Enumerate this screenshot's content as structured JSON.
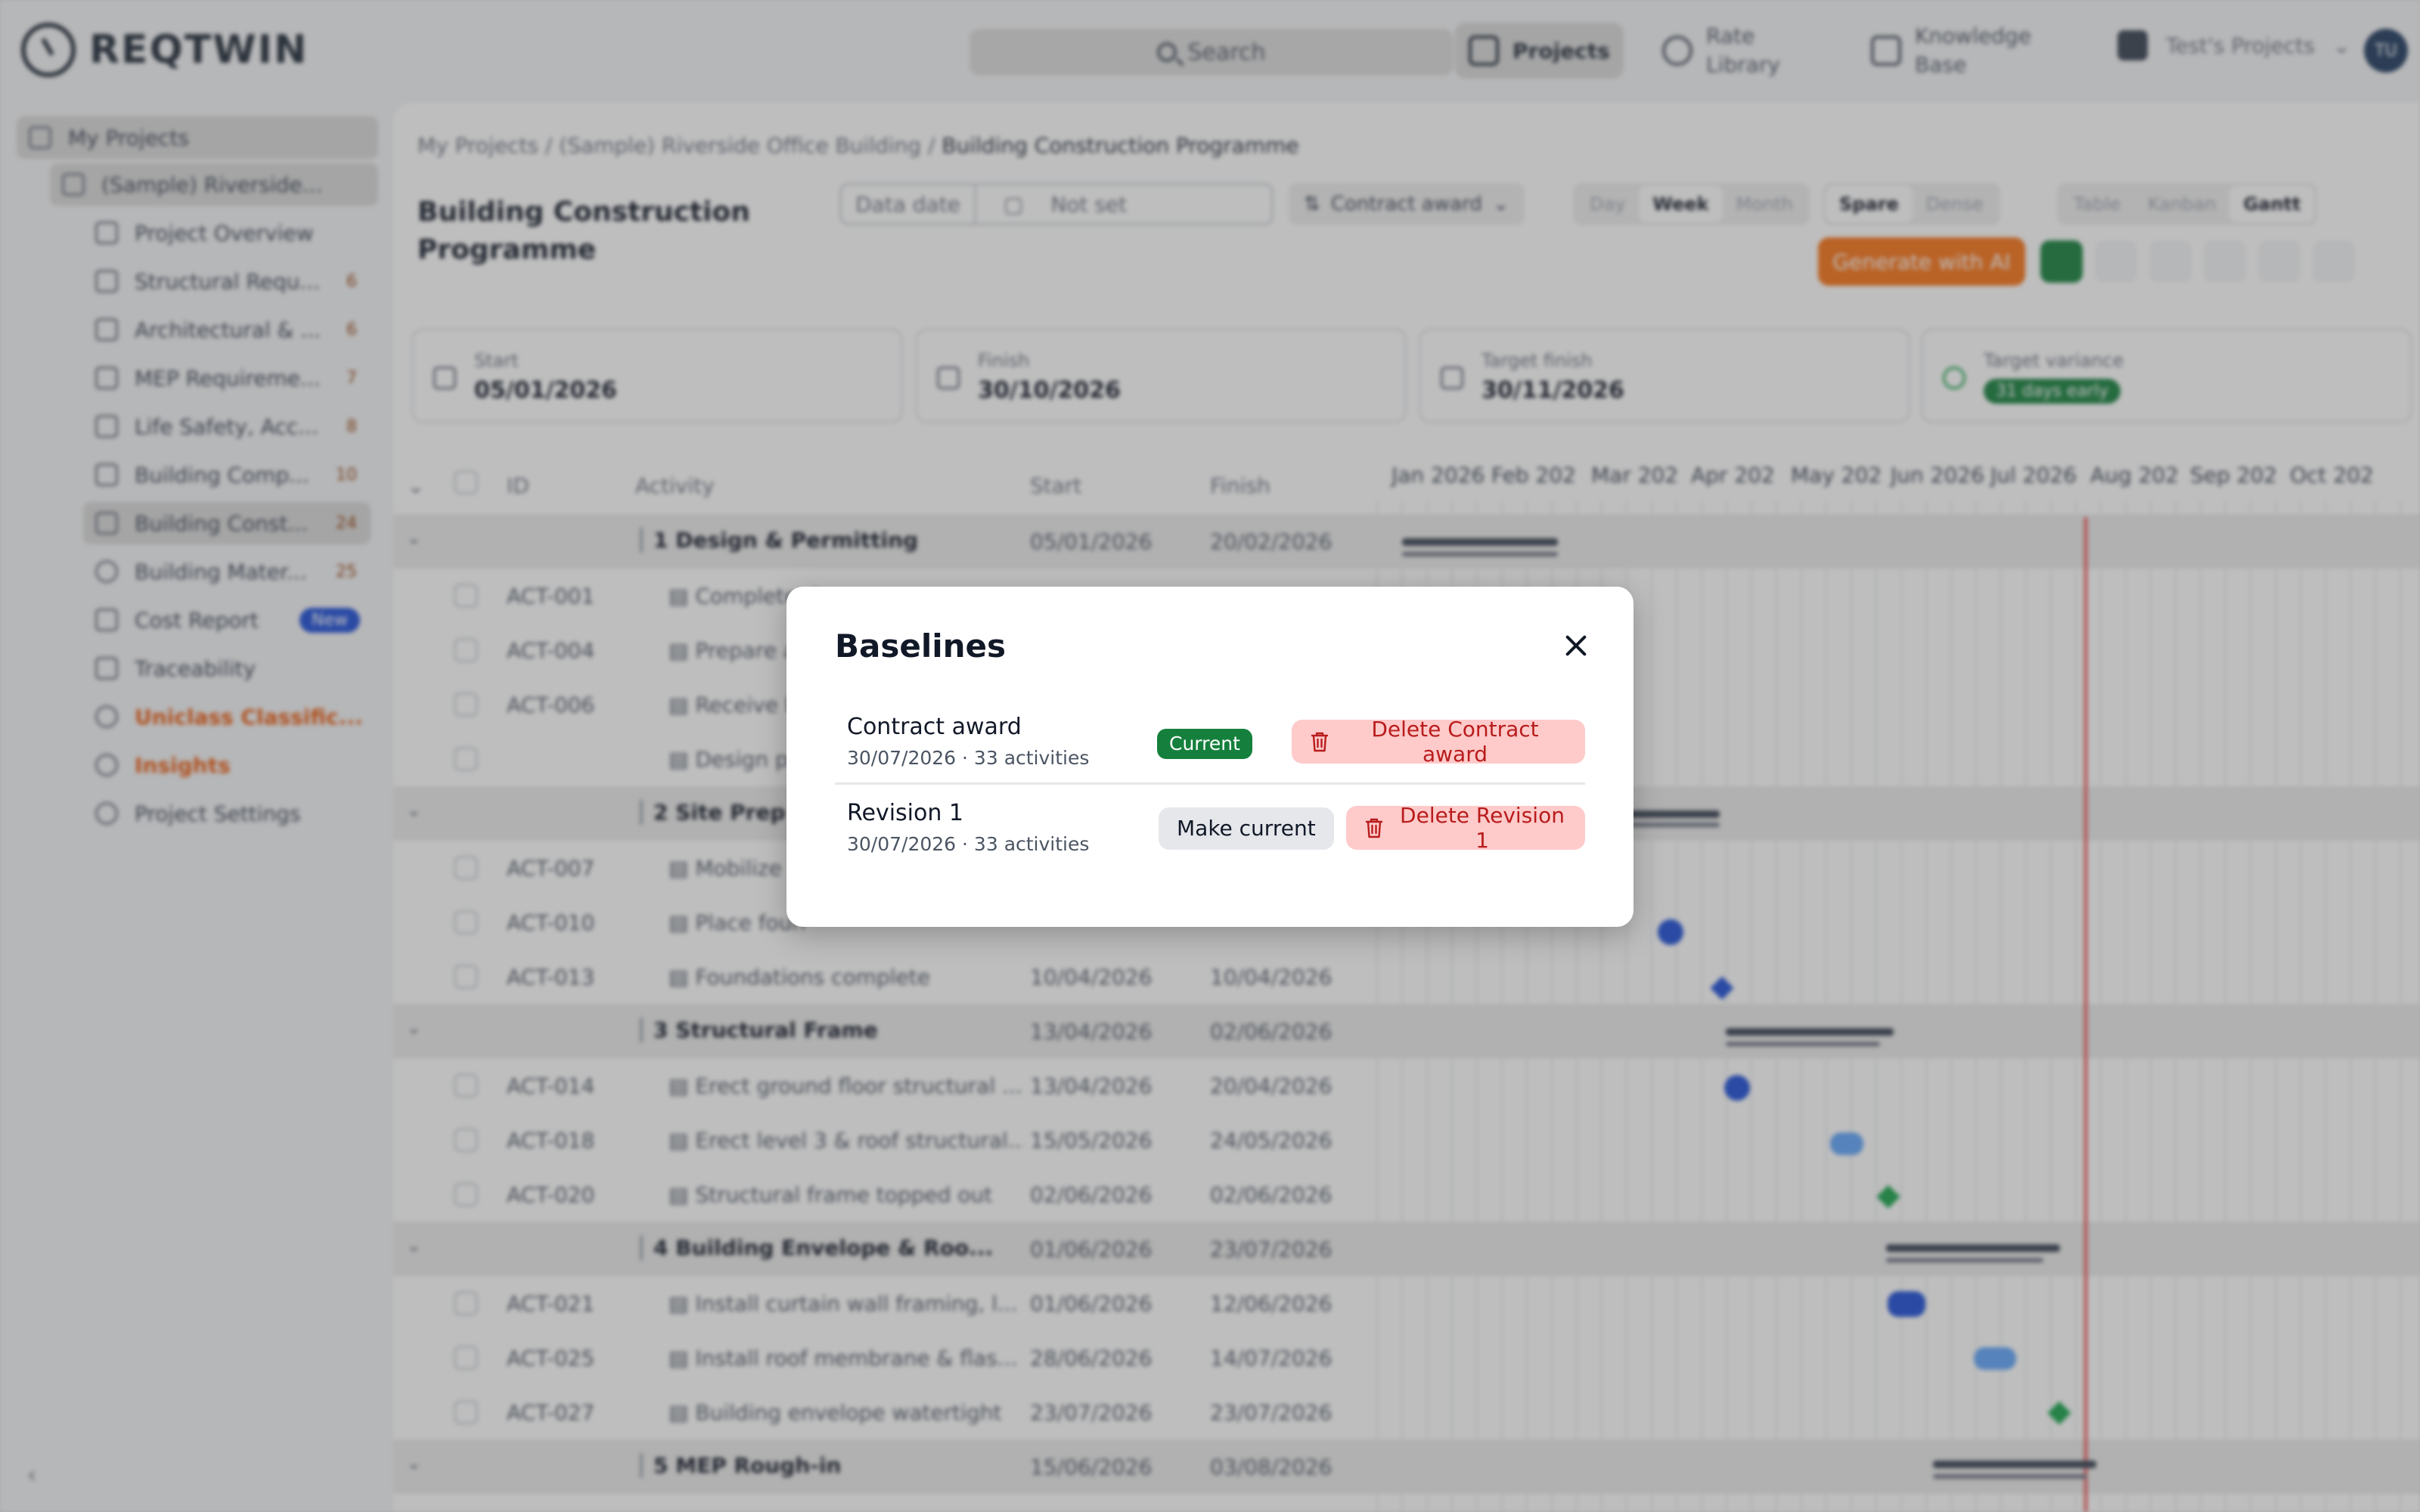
{
  "app": {
    "logo_text": "REQTWIN"
  },
  "topbar": {
    "search_label": "Search",
    "nav": [
      {
        "label": "Projects",
        "icon": "projects-icon",
        "active": true
      },
      {
        "label": "Rate Library",
        "icon": "link-icon"
      },
      {
        "label": "Knowledge Base",
        "icon": "book-icon"
      }
    ],
    "project_selector": "Test's Projects",
    "avatar_initials": "TU"
  },
  "sidebar": {
    "items": [
      {
        "label": "My Projects"
      },
      {
        "label": "(Sample) Riverside..."
      },
      {
        "label": "Project Overview"
      },
      {
        "label": "Structural Requ...",
        "badge": "6"
      },
      {
        "label": "Architectural & ...",
        "badge": "6"
      },
      {
        "label": "MEP Requireme...",
        "badge": "7"
      },
      {
        "label": "Life Safety, Acc...",
        "badge": "8"
      },
      {
        "label": "Building Comp...",
        "badge": "10"
      },
      {
        "label": "Building Const...",
        "badge": "24"
      },
      {
        "label": "Building Mater...",
        "badge": "25"
      },
      {
        "label": "Cost Report",
        "badge": "New"
      },
      {
        "label": "Traceability"
      },
      {
        "label": "Uniclass Classific..."
      },
      {
        "label": "Insights"
      },
      {
        "label": "Project Settings"
      }
    ],
    "collapse_glyph": "‹"
  },
  "main": {
    "breadcrumb": {
      "root": "My Projects",
      "sep": "/",
      "project": "(Sample) Riverside Office Building",
      "current": "Building Construction Programme"
    },
    "title": "Building Construction Programme",
    "data_date_label": "Data date",
    "data_date_value": "Not set",
    "baseline_select": "Contract award",
    "scale": [
      "Day",
      "Week",
      "Month"
    ],
    "density": [
      "Spare",
      "Dense"
    ],
    "views": [
      "Table",
      "Kanban",
      "Gantt"
    ],
    "generate_ai": "Generate with AI",
    "cards": [
      {
        "label": "Start",
        "value": "05/01/2026"
      },
      {
        "label": "Finish",
        "value": "30/10/2026"
      },
      {
        "label": "Target finish",
        "value": "30/11/2026"
      },
      {
        "label": "Target variance",
        "value": "31 days early"
      }
    ],
    "columns": [
      "ID",
      "Activity",
      "Start",
      "Finish"
    ],
    "months": [
      "Jan 2026",
      "Feb 202",
      "Mar 202",
      "Apr 202",
      "May 202",
      "Jun 2026",
      "Jul 2026",
      "Aug 202",
      "Sep 202",
      "Oct 202"
    ],
    "rows": [
      {
        "group": true,
        "name": "1 Design & Permitting",
        "start": "05/01/2026",
        "finish": "20/02/2026"
      },
      {
        "id": "ACT-001",
        "activity": "Complete d",
        "start": "",
        "finish": ""
      },
      {
        "id": "ACT-004",
        "activity": "Prepare an",
        "start": "",
        "finish": ""
      },
      {
        "id": "ACT-006",
        "activity": "Receive bu",
        "start": "",
        "finish": ""
      },
      {
        "id": "",
        "activity": "Design pha",
        "start": "",
        "finish": ""
      },
      {
        "group": true,
        "name": "2 Site Prep",
        "start": "",
        "finish": ""
      },
      {
        "id": "ACT-007",
        "activity": "Mobilize sit",
        "start": "",
        "finish": ""
      },
      {
        "id": "ACT-010",
        "activity": "Place foun",
        "start": "",
        "finish": ""
      },
      {
        "id": "ACT-013",
        "activity": "Foundations complete",
        "start": "10/04/2026",
        "finish": "10/04/2026"
      },
      {
        "group": true,
        "name": "3 Structural Frame",
        "start": "13/04/2026",
        "finish": "02/06/2026"
      },
      {
        "id": "ACT-014",
        "activity": "Erect ground floor structural ...",
        "start": "13/04/2026",
        "finish": "20/04/2026"
      },
      {
        "id": "ACT-018",
        "activity": "Erect level 3 & roof structural...",
        "start": "15/05/2026",
        "finish": "24/05/2026"
      },
      {
        "id": "ACT-020",
        "activity": "Structural frame topped out",
        "start": "02/06/2026",
        "finish": "02/06/2026"
      },
      {
        "group": true,
        "name": "4 Building Envelope & Roo...",
        "start": "01/06/2026",
        "finish": "23/07/2026"
      },
      {
        "id": "ACT-021",
        "activity": "Install curtain wall framing, l...",
        "start": "01/06/2026",
        "finish": "12/06/2026"
      },
      {
        "id": "ACT-025",
        "activity": "Install roof membrane & flas...",
        "start": "28/06/2026",
        "finish": "14/07/2026"
      },
      {
        "id": "ACT-027",
        "activity": "Building envelope watertight",
        "start": "23/07/2026",
        "finish": "23/07/2026"
      },
      {
        "group": true,
        "name": "5 MEP Rough-in",
        "start": "15/06/2026",
        "finish": "03/08/2026"
      }
    ]
  },
  "modal": {
    "title": "Baselines",
    "baselines": [
      {
        "name": "Contract award",
        "meta": "30/07/2026 · 33 activities",
        "current_badge": "Current",
        "delete_label": "Delete Contract award"
      },
      {
        "name": "Revision 1",
        "meta": "30/07/2026 · 33 activities",
        "make_current_label": "Make current",
        "delete_label": "Delete Revision 1"
      }
    ]
  },
  "colors": {
    "accent_orange": "#f97316",
    "current_green": "#15803d",
    "delete_bg": "#fecaca",
    "delete_text": "#b91c1c",
    "today_line": "#ef4444"
  }
}
